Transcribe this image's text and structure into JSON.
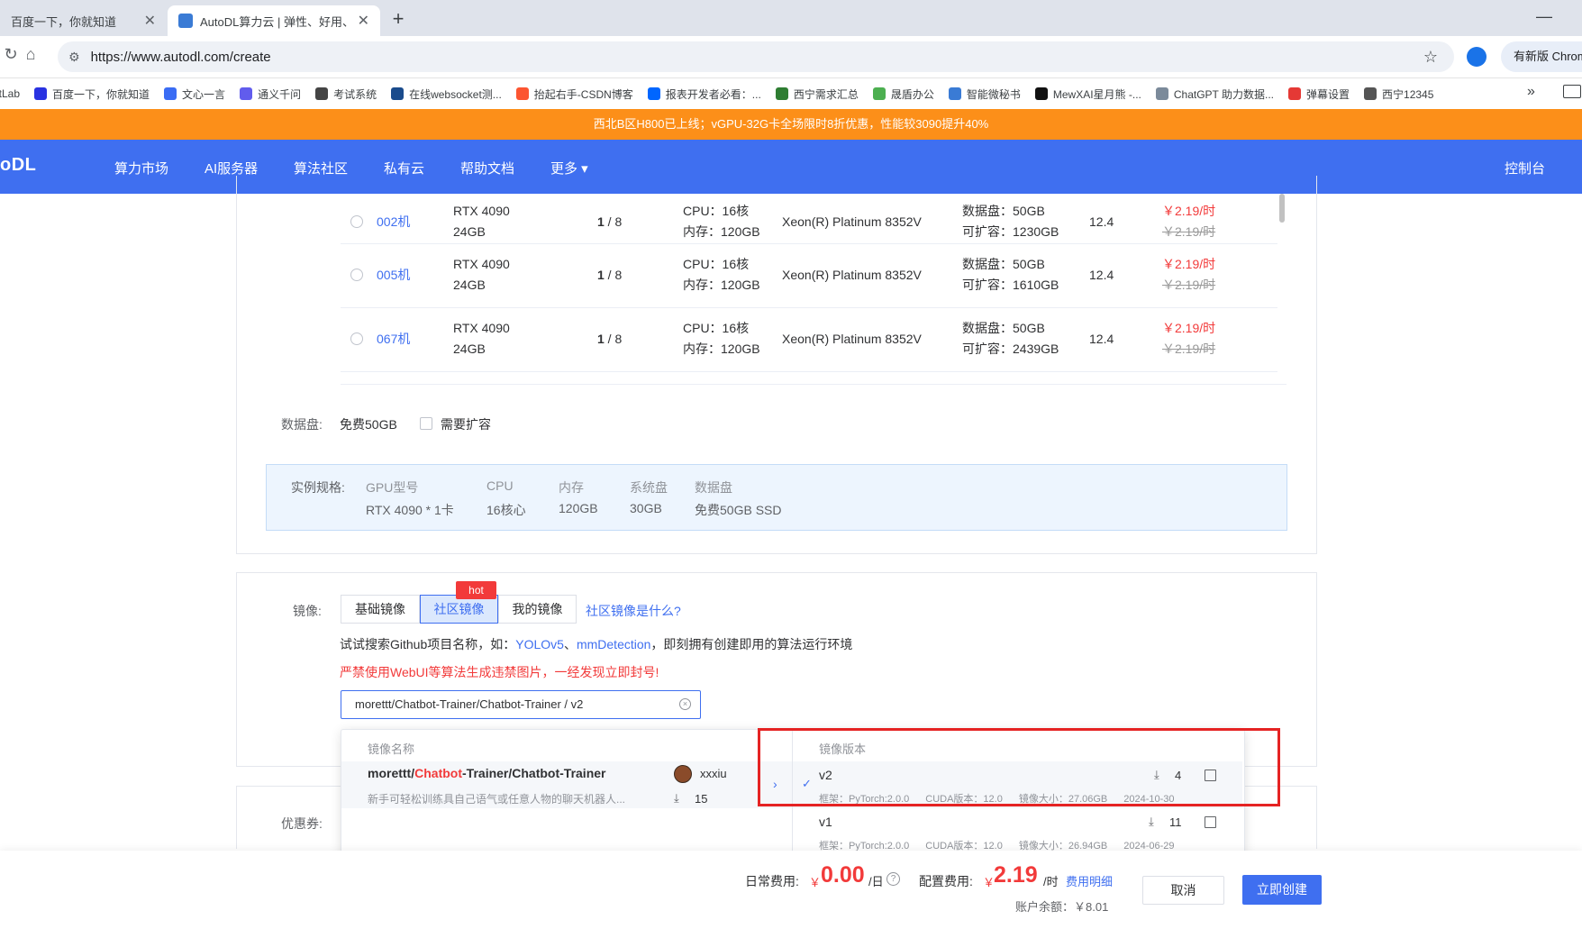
{
  "browser": {
    "tabs": [
      {
        "title": "百度一下，你就知道",
        "active": false
      },
      {
        "title": "AutoDL算力云 | 弹性、好用、省",
        "active": true
      }
    ],
    "url": "https://www.autodl.com/create",
    "new_version_label": "有新版 Chrom",
    "bookmarks": [
      {
        "label": "itLab",
        "color": "#e24329"
      },
      {
        "label": "百度一下，你就知道",
        "color": "#2932e1"
      },
      {
        "label": "文心一言",
        "color": "#3a6cf4"
      },
      {
        "label": "通义千问",
        "color": "#615ced"
      },
      {
        "label": "考试系统",
        "color": "#444444"
      },
      {
        "label": "在线websocket测...",
        "color": "#1a4b8c"
      },
      {
        "label": "抬起右手-CSDN博客",
        "color": "#fc5531"
      },
      {
        "label": "报表开发者必看：...",
        "color": "#0066ff"
      },
      {
        "label": "西宁需求汇总",
        "color": "#2e7d32"
      },
      {
        "label": "晟盾办公",
        "color": "#4caf50"
      },
      {
        "label": "智能微秘书",
        "color": "#3a7bd5"
      },
      {
        "label": "MewXAI星月熊 -...",
        "color": "#111111"
      },
      {
        "label": "ChatGPT 助力数据...",
        "color": "#7b8a9a"
      },
      {
        "label": "弹幕设置",
        "color": "#e53935"
      },
      {
        "label": "西宁12345",
        "color": "#555555"
      }
    ]
  },
  "banner": {
    "text": "西北B区H800已上线；vGPU-32G卡全场限时8折优惠，性能较3090提升40%"
  },
  "nav": {
    "logo": "oDL",
    "items": [
      "算力市场",
      "AI服务器",
      "算法社区",
      "私有云",
      "帮助文档",
      "更多 ▾"
    ],
    "console": "控制台"
  },
  "gpu_rows": [
    {
      "id": "002机",
      "gpu": "RTX 4090",
      "vram": "24GB",
      "free": "1",
      "total": " / 8",
      "cpu": "CPU：16核",
      "mem": "内存：120GB",
      "cpu_model": "Xeon(R) Platinum 8352V",
      "disk": "数据盘：50GB",
      "expand": "可扩容：1230GB",
      "cuda": "12.4",
      "price": "￥2.19/时",
      "orig_price": "￥2.19/时"
    },
    {
      "id": "005机",
      "gpu": "RTX 4090",
      "vram": "24GB",
      "free": "1",
      "total": " / 8",
      "cpu": "CPU：16核",
      "mem": "内存：120GB",
      "cpu_model": "Xeon(R) Platinum 8352V",
      "disk": "数据盘：50GB",
      "expand": "可扩容：1610GB",
      "cuda": "12.4",
      "price": "￥2.19/时",
      "orig_price": "￥2.19/时"
    },
    {
      "id": "067机",
      "gpu": "RTX 4090",
      "vram": "24GB",
      "free": "1",
      "total": " / 8",
      "cpu": "CPU：16核",
      "mem": "内存：120GB",
      "cpu_model": "Xeon(R) Platinum 8352V",
      "disk": "数据盘：50GB",
      "expand": "可扩容：2439GB",
      "cuda": "12.4",
      "price": "￥2.19/时",
      "orig_price": "￥2.19/时"
    }
  ],
  "data_disk": {
    "label": "数据盘:",
    "value": "免费50GB",
    "expand_label": "需要扩容"
  },
  "spec": {
    "label": "实例规格:",
    "headers": [
      "GPU型号",
      "CPU",
      "内存",
      "系统盘",
      "数据盘"
    ],
    "values": [
      "RTX 4090 * 1卡",
      "16核心",
      "120GB",
      "30GB",
      "免费50GB SSD"
    ]
  },
  "image": {
    "label": "镜像:",
    "tabs": [
      "基础镜像",
      "社区镜像",
      "我的镜像"
    ],
    "hot_badge": "hot",
    "what_link": "社区镜像是什么?",
    "tip_prefix": "试试搜索Github项目名称，如：",
    "tip_link1": "YOLOv5",
    "tip_sep": "、",
    "tip_link2": "mmDetection",
    "tip_suffix": "，即刻拥有创建即用的算法运行环境",
    "warning": "严禁使用WebUI等算法生成违禁图片，一经发现立即封号!",
    "search_value": "morettt/Chatbot-Trainer/Chatbot-Trainer / v2",
    "clear_icon": "×"
  },
  "dropdown": {
    "name_header": "镜像名称",
    "version_header": "镜像版本",
    "result": {
      "name_prefix": "morettt/",
      "name_highlight": "Chatbot",
      "name_suffix": "-Trainer/Chatbot-Trainer",
      "description": "新手可轻松训练具自己语气或任意人物的聊天机器人...",
      "owner": "xxxiu",
      "downloads": "15"
    },
    "versions": [
      {
        "name": "v2",
        "framework": "框架：PyTorch:2.0.0",
        "cuda": "CUDA版本：12.0",
        "size": "镜像大小：27.06GB",
        "date": "2024-10-30",
        "downloads": "4",
        "selected": true
      },
      {
        "name": "v1",
        "framework": "框架：PyTorch:2.0.0",
        "cuda": "CUDA版本：12.0",
        "size": "镜像大小：26.94GB",
        "date": "2024-06-29",
        "downloads": "11",
        "selected": false
      }
    ]
  },
  "coupon": {
    "label": "优惠券:"
  },
  "footer": {
    "daily_label": "日常费用:",
    "daily_yen": "￥",
    "daily_amount": "0.00",
    "daily_unit": "/日",
    "help_icon": "?",
    "cfg_label": "配置费用:",
    "cfg_yen": "￥",
    "cfg_amount": "2.19",
    "cfg_unit": "/时",
    "detail_link": "费用明细",
    "balance": "账户余额：￥8.01",
    "cancel": "取消",
    "create": "立即创建"
  },
  "colors": {
    "primary": "#3f6ff0",
    "banner": "#fc8f19",
    "price_red": "#f23a3a",
    "highlight_box": "#e52323"
  }
}
